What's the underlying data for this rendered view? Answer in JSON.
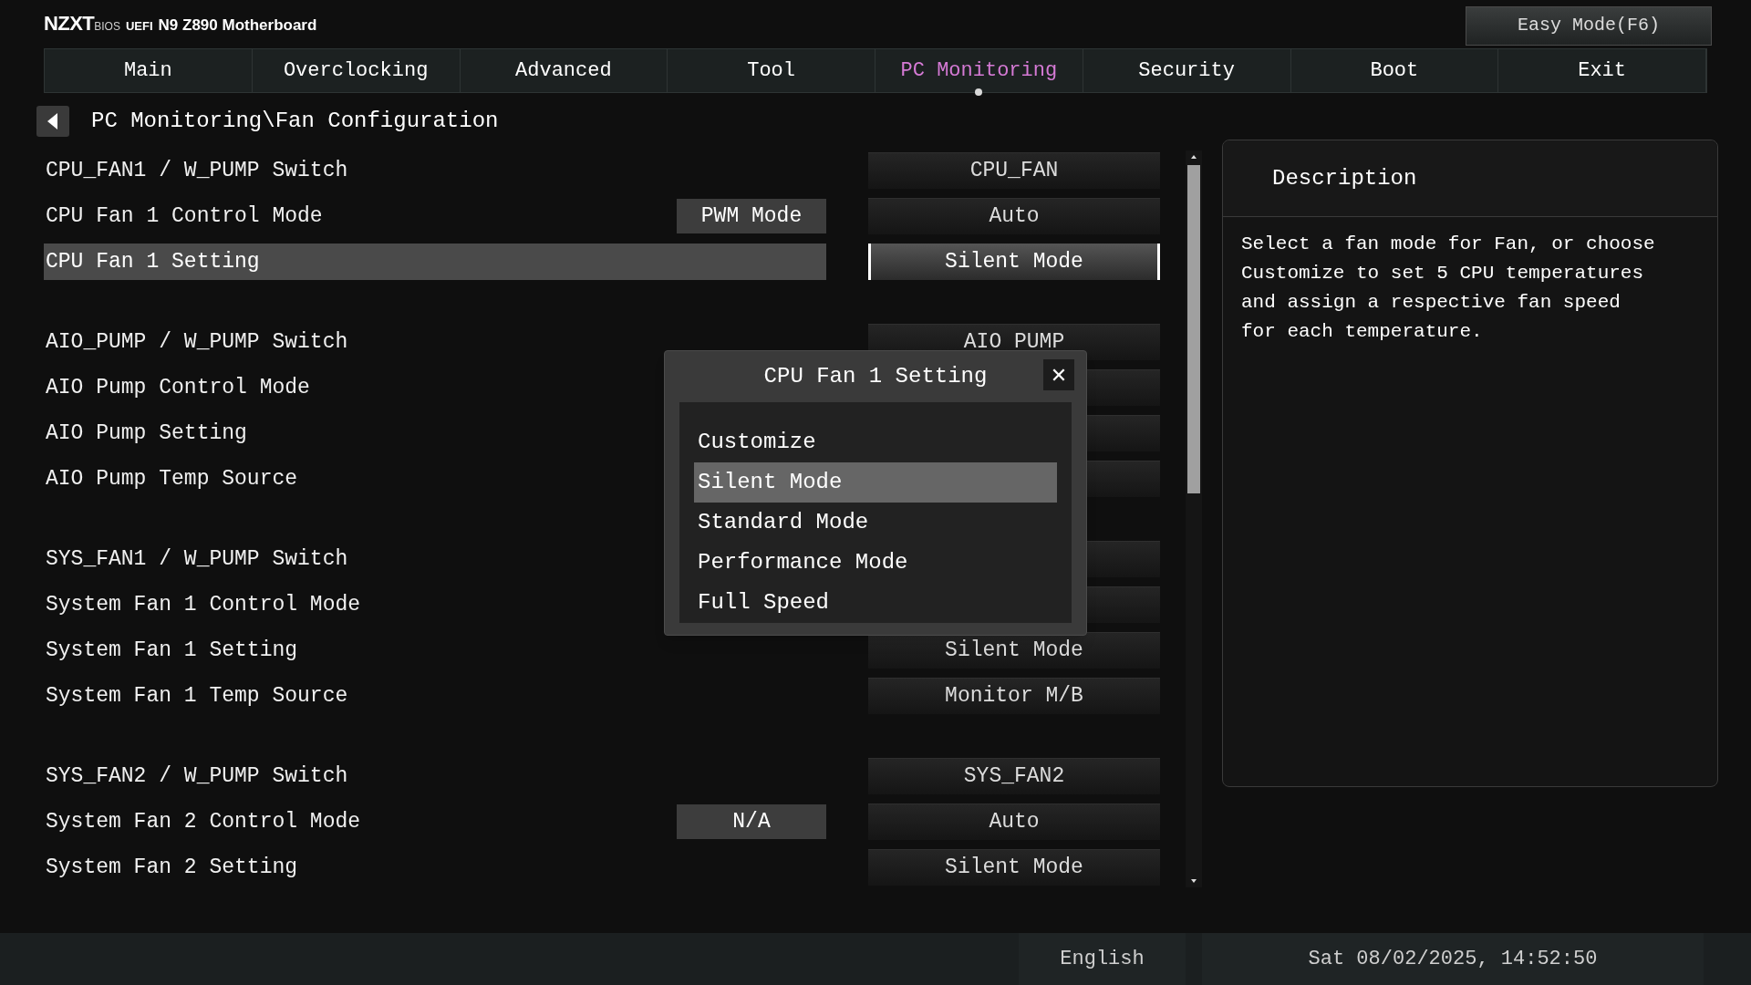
{
  "header": {
    "brand": "NZXT",
    "sub_1": "BIOS",
    "sub_2": "UEFI",
    "model": "N9 Z890 Motherboard",
    "easy_mode_button": "Easy Mode(F6)"
  },
  "tabs": [
    {
      "label": "Main",
      "selected": false
    },
    {
      "label": "Overclocking",
      "selected": false
    },
    {
      "label": "Advanced",
      "selected": false
    },
    {
      "label": "Tool",
      "selected": false
    },
    {
      "label": "PC Monitoring",
      "selected": true
    },
    {
      "label": "Security",
      "selected": false
    },
    {
      "label": "Boot",
      "selected": false
    },
    {
      "label": "Exit",
      "selected": false
    }
  ],
  "breadcrumb": "PC Monitoring\\Fan Configuration",
  "sections": [
    {
      "rows": [
        {
          "label": "CPU_FAN1 / W_PUMP Switch",
          "selected": false,
          "value": "CPU_FAN"
        },
        {
          "label": "CPU Fan 1 Control Mode",
          "selected": false,
          "badge": "PWM Mode",
          "value": "Auto"
        },
        {
          "label": "CPU Fan 1 Setting",
          "selected": true,
          "value": "Silent Mode"
        }
      ]
    },
    {
      "rows": [
        {
          "label": "AIO_PUMP / W_PUMP Switch",
          "selected": false,
          "value": "AIO PUMP"
        },
        {
          "label": "AIO Pump Control Mode",
          "selected": false
        },
        {
          "label": "AIO Pump Setting",
          "selected": false
        },
        {
          "label": "AIO Pump Temp Source",
          "selected": false
        }
      ]
    },
    {
      "rows": [
        {
          "label": "SYS_FAN1 / W_PUMP Switch",
          "selected": false
        },
        {
          "label": "System Fan 1 Control Mode",
          "selected": false
        },
        {
          "label": "System Fan 1 Setting",
          "selected": false,
          "value": "Silent Mode"
        },
        {
          "label": "System Fan 1 Temp Source",
          "selected": false,
          "value": "Monitor M/B"
        }
      ]
    },
    {
      "rows": [
        {
          "label": "SYS_FAN2 / W_PUMP Switch",
          "selected": false,
          "value": "SYS_FAN2"
        },
        {
          "label": "System Fan 2 Control Mode",
          "selected": false,
          "badge": "N/A",
          "value": "Auto"
        },
        {
          "label": "System Fan 2 Setting",
          "selected": false,
          "value": "Silent Mode"
        }
      ]
    }
  ],
  "description": {
    "title": "Description",
    "text": "Select a fan mode for Fan, or choose Customize to set 5 CPU temperatures and assign a respective fan speed for each temperature."
  },
  "dialog": {
    "title": "CPU Fan 1 Setting",
    "close": "✕",
    "options": [
      {
        "label": "Customize",
        "selected": false
      },
      {
        "label": "Silent Mode",
        "selected": true
      },
      {
        "label": "Standard Mode",
        "selected": false
      },
      {
        "label": "Performance Mode",
        "selected": false
      },
      {
        "label": "Full Speed",
        "selected": false
      }
    ]
  },
  "status_bar": {
    "language": "English",
    "datetime": "Sat 08/02/2025, 14:52:50"
  }
}
